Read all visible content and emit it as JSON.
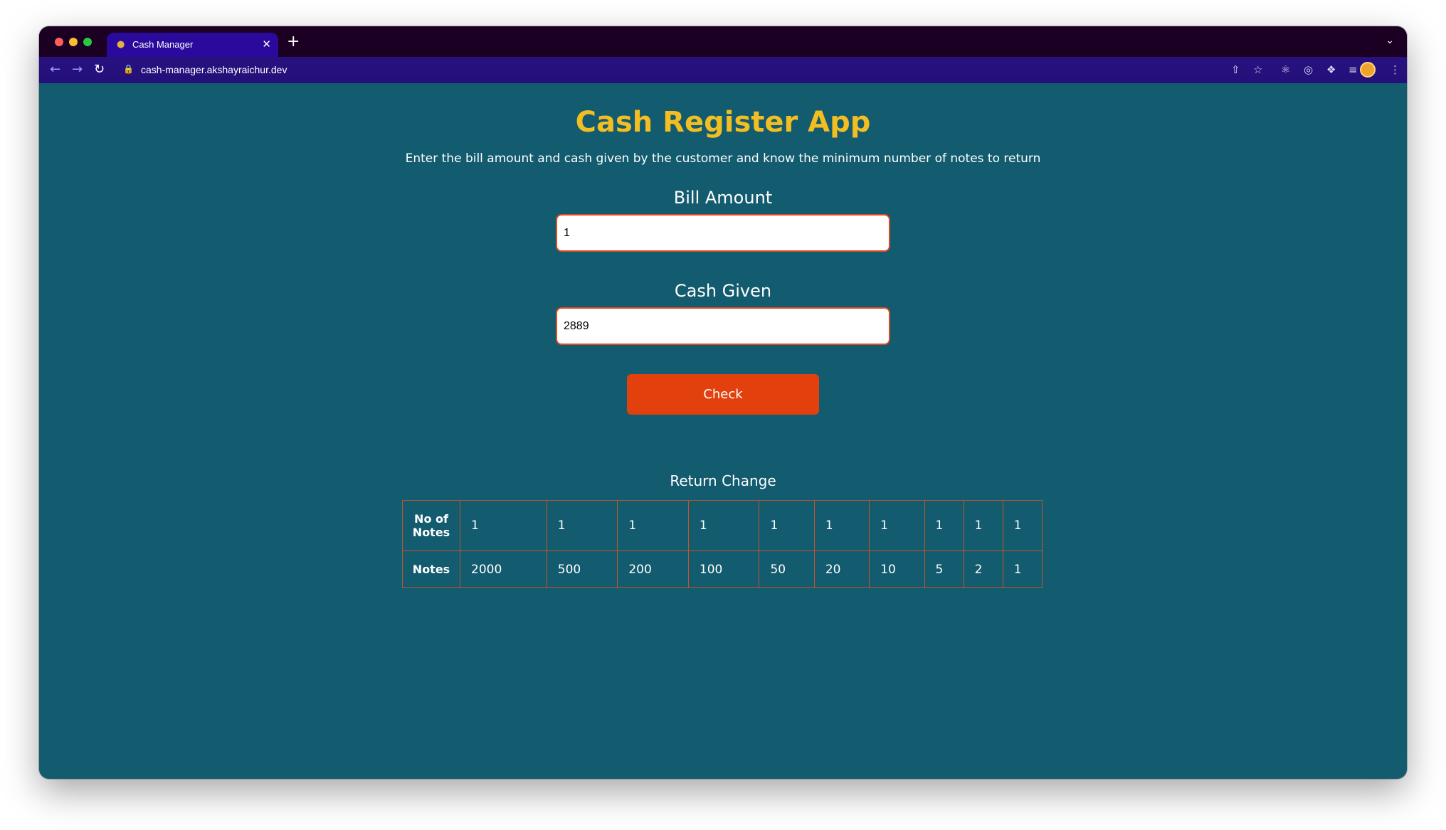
{
  "browser": {
    "tab_title": "Cash Manager",
    "tab_favicon": "money-bag-icon",
    "url": "cash-manager.akshayraichur.dev"
  },
  "app": {
    "title": "Cash Register App",
    "subtitle": "Enter the bill amount and cash given by the customer and know the minimum number of notes to return",
    "bill_label": "Bill Amount",
    "bill_value": "1",
    "cash_label": "Cash Given",
    "cash_value": "2889",
    "check_label": "Check",
    "return_title": "Return Change",
    "table": {
      "count_header": "No of Notes",
      "notes_header": "Notes",
      "counts": [
        "1",
        "1",
        "1",
        "1",
        "1",
        "1",
        "1",
        "1",
        "1",
        "1"
      ],
      "notes": [
        "2000",
        "500",
        "200",
        "100",
        "50",
        "20",
        "10",
        "5",
        "2",
        "1"
      ]
    }
  },
  "colors": {
    "page_bg": "#135b6e",
    "title": "#f2be22",
    "button": "#e2400c",
    "border": "#c1572b",
    "tab_active": "#2a0a9c"
  }
}
